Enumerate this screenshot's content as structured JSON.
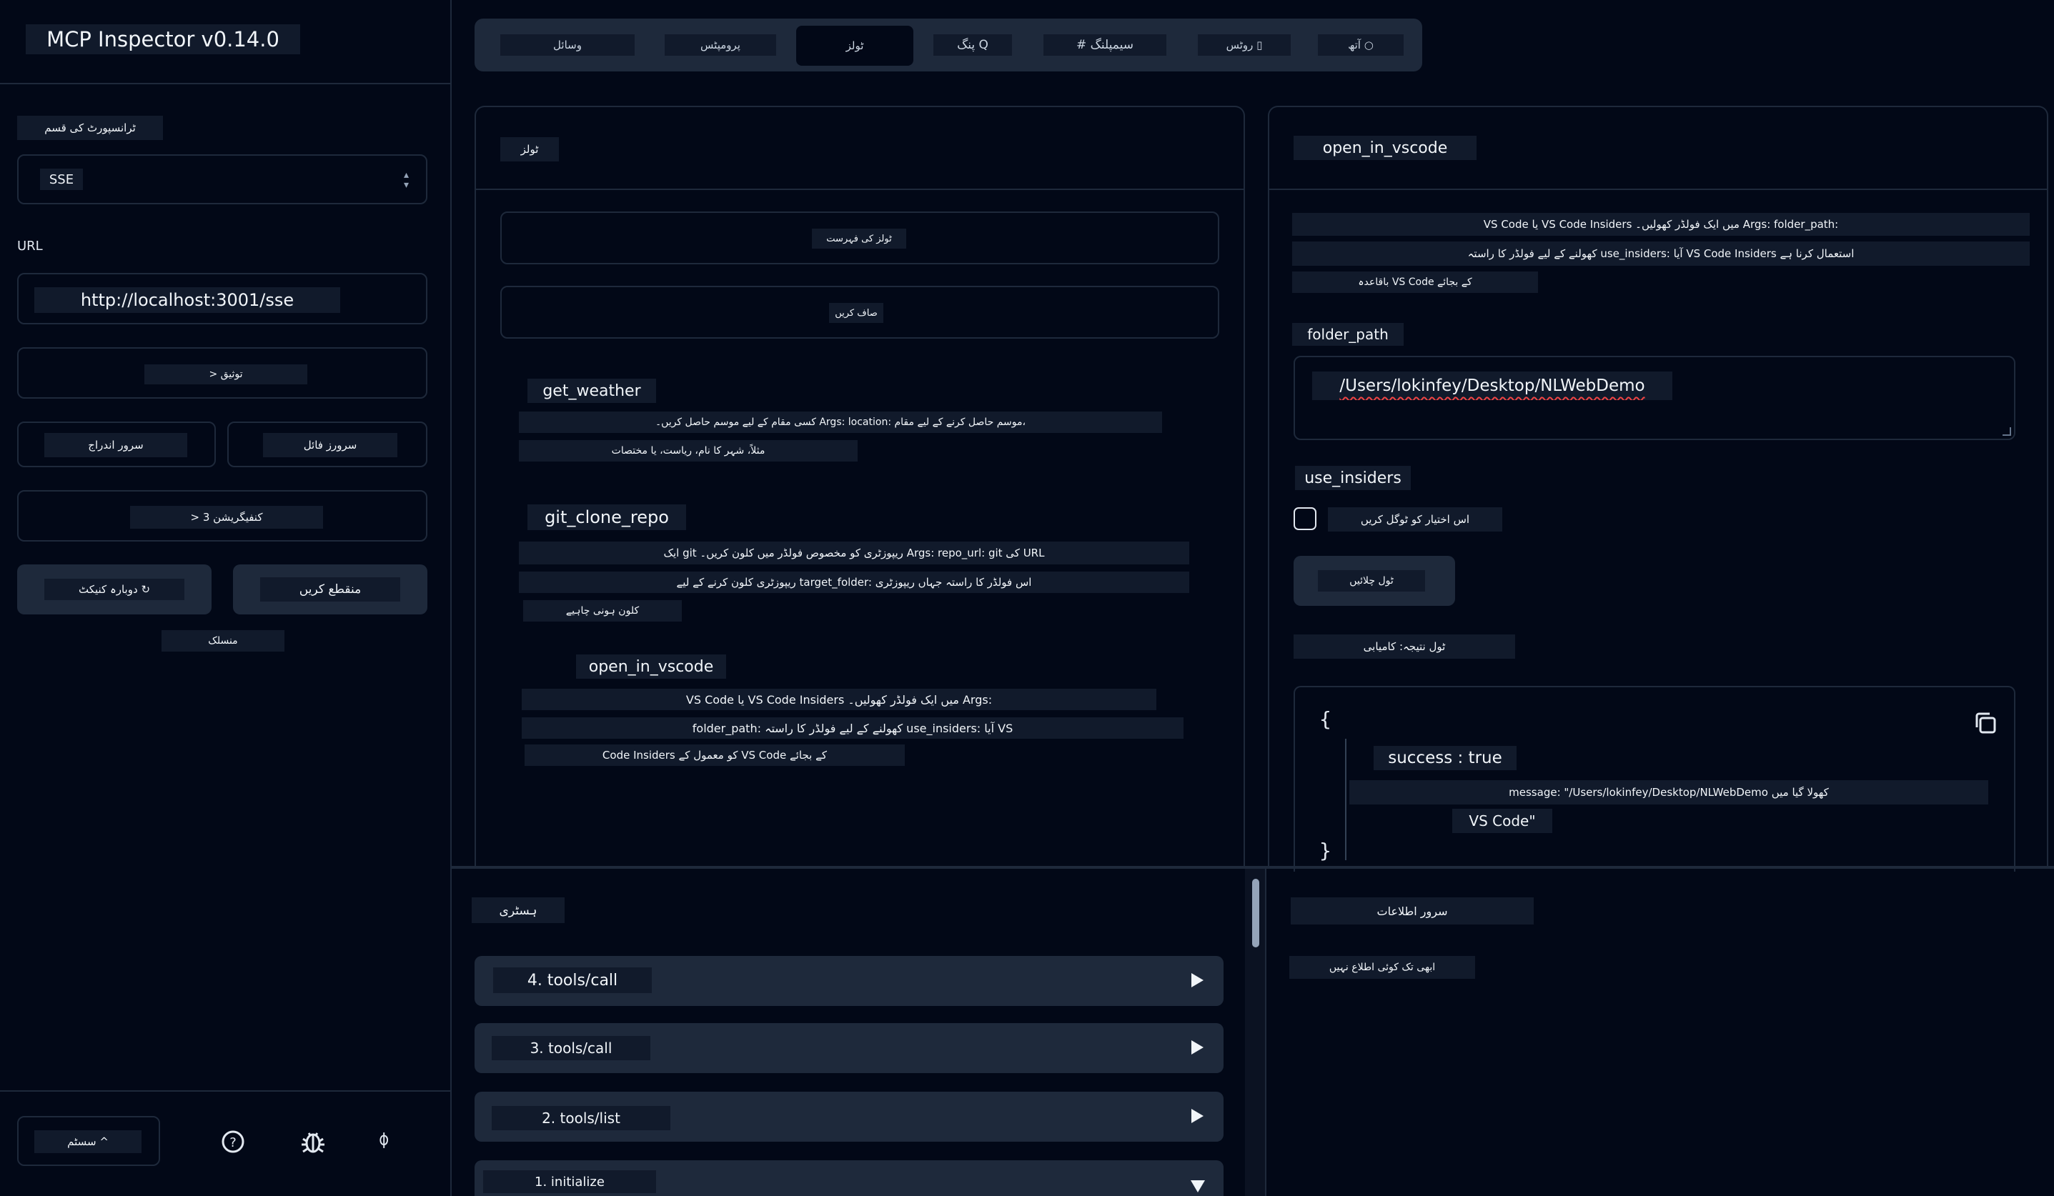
{
  "app": {
    "title": "MCP Inspector v0.14.0"
  },
  "sidebar": {
    "transport_label": "ٹرانسپورٹ کی قسم",
    "transport_value": "SSE",
    "url_label": "URL",
    "url_value": "http://localhost:3001/sse",
    "auth_button": "> توثیق",
    "server_entry_button": "سرور اندراج",
    "server_file_button": "سرورز فائل",
    "config_button": "> 3 کنفیگریشن",
    "reconnect_button": "دوبارہ کنیکٹ ↻",
    "disconnect_button": "منقطع کریں",
    "status_text": "منسلک",
    "theme_button": "سسٹم ^",
    "footer_icons": [
      "help-icon",
      "bug-icon",
      "github-icon"
    ]
  },
  "tabs": [
    {
      "label": "وسائل",
      "icon": "files-icon"
    },
    {
      "label": "پرومپٹس",
      "icon": "message-icon"
    },
    {
      "label": "ٹولز",
      "icon": "hammer-icon",
      "active": true
    },
    {
      "label": "پنگ Q",
      "icon": "bell-icon"
    },
    {
      "label": "# سیمپلنگ",
      "icon": "hash-icon"
    },
    {
      "label": "روٹس ▯",
      "icon": "folder-tree-icon"
    },
    {
      "label": "آتھ ○",
      "icon": "key-icon"
    }
  ],
  "tools_panel": {
    "title": "ٹولز",
    "list_button": "ٹولز کی فہرست",
    "clear_button": "صاف کریں",
    "tools": [
      {
        "name": "get_weather",
        "desc_lines": [
          "کسی مقام کے لیے موسم حاصل کریں۔ Args: location: موسم حاصل کرنے کے لیے مقام،",
          "مثلاً، شہر کا نام، ریاست، یا مختصات"
        ]
      },
      {
        "name": "git_clone_repo",
        "desc_lines": [
          "ایک git ریپوزٹری کو مخصوص فولڈر میں کلون کریں۔ Args: repo_url: git کی URL",
          "ریپوزٹری کلون کرنے کے لیے target_folder: اس فولڈر کا راستہ جہاں ریپوزٹری",
          "کلون ہونی چاہیے"
        ]
      },
      {
        "name": "open_in_vscode",
        "desc_lines": [
          "VS Code یا VS Code Insiders میں ایک فولڈر کھولیں۔ Args:",
          "folder_path: کھولنے کے لیے فولڈر کا راستہ use_insiders: آیا VS",
          "Code Insiders کو معمول کے VS Code کے بجائے"
        ]
      }
    ]
  },
  "detail_panel": {
    "title": "open_in_vscode",
    "desc_lines": [
      "VS Code یا VS Code Insiders میں ایک فولڈر کھولیں۔ Args: folder_path:",
      "کھولنے کے لیے فولڈر کا راستہ use_insiders: آیا VS Code Insiders استعمال کرنا ہے",
      "باقاعدہ VS Code کے بجائے"
    ],
    "field1_label": "folder_path",
    "field1_value": "/Users/lokinfey/Desktop/NLWebDemo",
    "field2_label": "use_insiders",
    "toggle_label": "اس اختیار کو ٹوگل کریں",
    "run_button": "ٹول چلائیں",
    "result_label": "ٹول نتیجہ: کامیابی",
    "json_open": "{",
    "json_success": "success : true",
    "json_message": "message: \"/Users/lokinfey/Desktop/NLWebDemo کھولا گیا میں",
    "json_message2": "VS Code\"",
    "json_close": "}"
  },
  "history": {
    "title": "ہسٹری",
    "items": [
      "4. tools/call",
      "3. tools/call",
      "2. tools/list",
      "1. initialize"
    ]
  },
  "notifications": {
    "title": "سرور اطلاعات",
    "empty": "ابھی تک کوئی اطلاع نہیں"
  }
}
